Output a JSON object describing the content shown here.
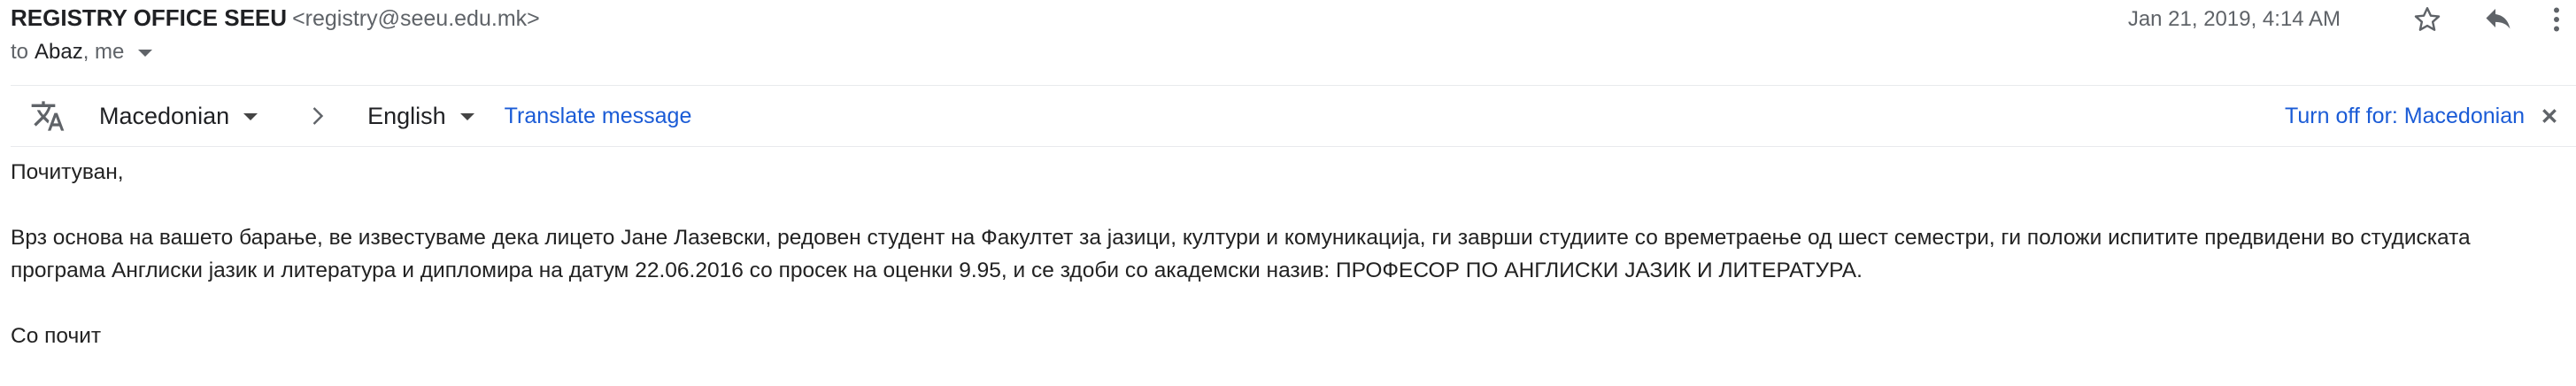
{
  "header": {
    "sender_name": "REGISTRY OFFICE SEEU",
    "sender_email": "<registry@seeu.edu.mk>",
    "to_prefix": "to",
    "recipients": "Abaz",
    "recipients_tail": ", me",
    "date": "Jan 21, 2019, 4:14 AM"
  },
  "icons": {
    "star": "star-icon",
    "reply": "reply-icon",
    "more": "more-vert-icon",
    "translate": "translate-icon",
    "arrow": "chevron-right-icon",
    "close": "close-icon"
  },
  "translate_bar": {
    "source_language": "Macedonian",
    "target_language": "English",
    "translate_link": "Translate message",
    "turn_off_link": "Turn off for: Macedonian"
  },
  "body": {
    "greeting": "Почитуван,",
    "paragraph": "Врз основа на вашето барање, ве известуваме дека лицето Јане Лазевски, редовен студент на Факултет за јазици, култури и комуникација, ги заврши студиите со времетраење од шест семестри, ги положи испитите предвидени во студиската програма Англиски јазик и литература и дипломира на датум 22.06.2016 со просек на оценки 9.95, и се здоби со академски назив: ПРОФЕСОР ПО АНГЛИСКИ ЈАЗИК И ЛИТЕРАТУРА.",
    "closing": "Со почит"
  },
  "colors": {
    "link": "#1a5bd6",
    "secondary_text": "#5f6368",
    "divider": "#e8eaed"
  }
}
